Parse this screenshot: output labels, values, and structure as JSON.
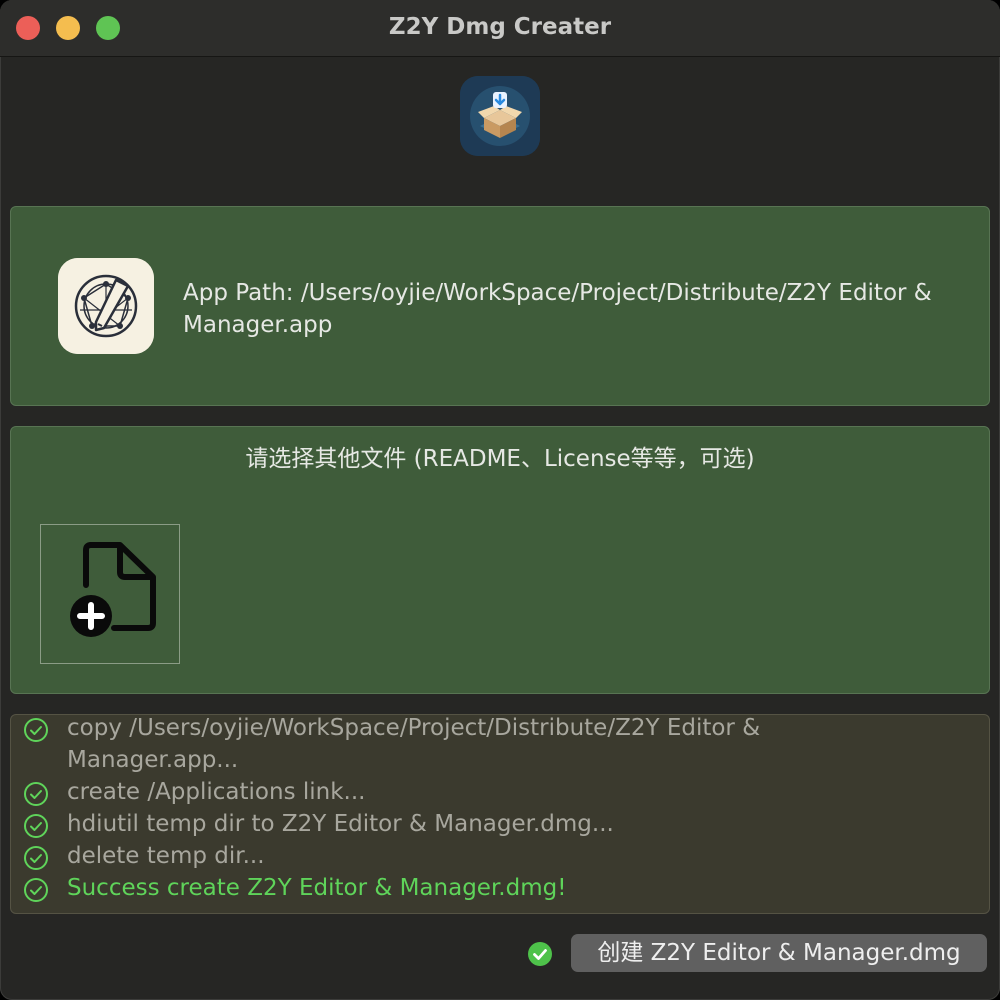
{
  "window": {
    "title": "Z2Y Dmg Creater"
  },
  "app": {
    "path_label": "App Path: /Users/oyjie/WorkSpace/Project/Distribute/Z2Y Editor & Manager.app"
  },
  "extra_files": {
    "title": "请选择其他文件 (README、License等等，可选)"
  },
  "log": {
    "entries": [
      {
        "text": "copy /Users/oyjie/WorkSpace/Project/Distribute/Z2Y Editor & Manager.app...",
        "status": "done"
      },
      {
        "text": "create /Applications link...",
        "status": "done"
      },
      {
        "text": "hdiutil temp dir to Z2Y Editor & Manager.dmg...",
        "status": "done"
      },
      {
        "text": "delete temp dir...",
        "status": "done"
      },
      {
        "text": "Success create Z2Y Editor & Manager.dmg!",
        "status": "success"
      }
    ]
  },
  "actions": {
    "create_label": "创建 Z2Y Editor & Manager.dmg"
  },
  "colors": {
    "window_bg": "#262624",
    "panel_green": "#3f5c3a",
    "log_bg": "#3b3a2e",
    "success_green": "#5fd45a",
    "button_gray": "#606060"
  }
}
